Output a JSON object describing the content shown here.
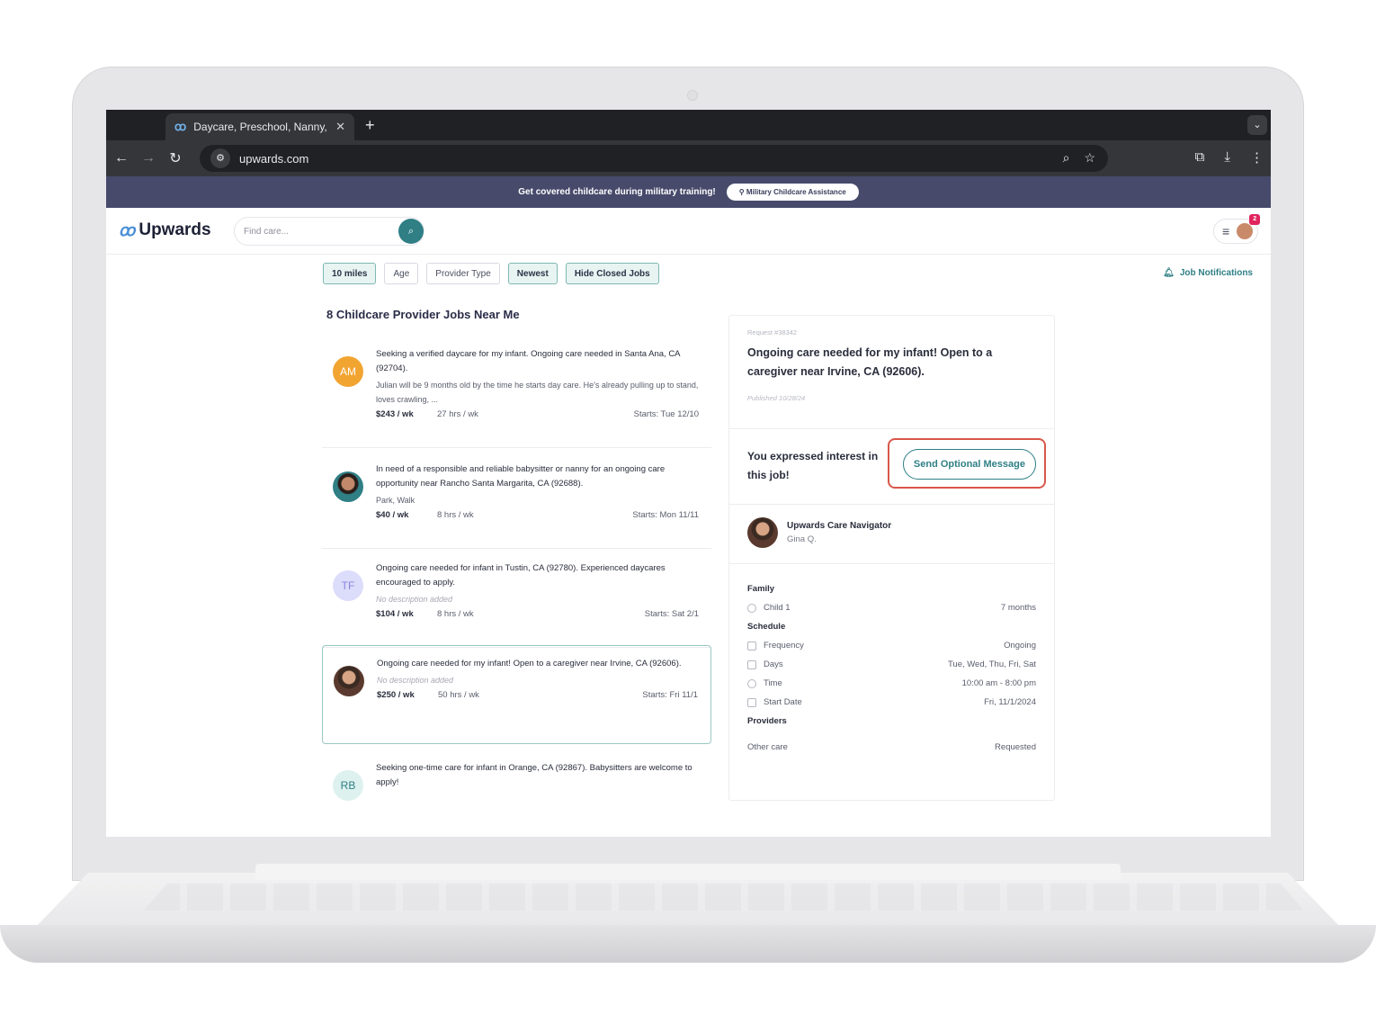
{
  "browser": {
    "tab_title": "Daycare, Preschool, Nanny, &",
    "url": "upwards.com"
  },
  "banner": {
    "text": "Get covered childcare during military training!",
    "button": "Military Childcare Assistance"
  },
  "header": {
    "logo": "Upwards",
    "search_placeholder": "Find care...",
    "badge_count": "2"
  },
  "filters": [
    "10 miles",
    "Age",
    "Provider Type",
    "Newest",
    "Hide Closed Jobs"
  ],
  "job_notifications": "Job Notifications",
  "list": {
    "title": "8 Childcare Provider Jobs Near Me",
    "jobs": [
      {
        "initials": "AM",
        "title": "Seeking a verified daycare for my infant. Ongoing care needed in Santa Ana, CA (92704).",
        "desc": "Julian will be 9 months old by the time he starts day care. He's already pulling up to stand, loves crawling, ...",
        "rate": "$243 / wk",
        "hours": "27 hrs / wk",
        "starts": "Starts: Tue 12/10"
      },
      {
        "initials": "",
        "title": "In need of a responsible and reliable babysitter or nanny for an ongoing care opportunity near Rancho Santa Margarita, CA (92688).",
        "desc": "Park, Walk",
        "rate": "$40 / wk",
        "hours": "8 hrs / wk",
        "starts": "Starts: Mon 11/11"
      },
      {
        "initials": "TF",
        "title": "Ongoing care needed for infant in Tustin, CA (92780). Experienced daycares encouraged to apply.",
        "desc": "No description added",
        "rate": "$104 / wk",
        "hours": "8 hrs / wk",
        "starts": "Starts: Sat 2/1"
      },
      {
        "initials": "",
        "title": "Ongoing care needed for my infant! Open to a caregiver near Irvine, CA (92606).",
        "desc": "No description added",
        "rate": "$250 / wk",
        "hours": "50 hrs / wk",
        "starts": "Starts: Fri 11/1"
      },
      {
        "initials": "RB",
        "title": "Seeking one-time care for infant in Orange, CA (92867). Babysitters are welcome to apply!",
        "desc": "",
        "rate": "",
        "hours": "",
        "starts": ""
      }
    ]
  },
  "detail": {
    "request_id": "Request #38342",
    "title": "Ongoing care needed for my infant! Open to a caregiver near Irvine, CA (92606).",
    "published": "Published 10/28/24",
    "interest_text": "You expressed interest in this job!",
    "send_button": "Send Optional Message",
    "navigator_role": "Upwards Care Navigator",
    "navigator_name": "Gina Q.",
    "family_head": "Family",
    "child_label": "Child 1",
    "child_value": "7 months",
    "schedule_head": "Schedule",
    "schedule": [
      {
        "label": "Frequency",
        "value": "Ongoing"
      },
      {
        "label": "Days",
        "value": "Tue, Wed, Thu, Fri, Sat"
      },
      {
        "label": "Time",
        "value": "10:00 am - 8:00 pm"
      },
      {
        "label": "Start Date",
        "value": "Fri, 11/1/2024"
      }
    ],
    "providers_head": "Providers",
    "other_care_label": "Other care",
    "other_care_value": "Requested"
  }
}
